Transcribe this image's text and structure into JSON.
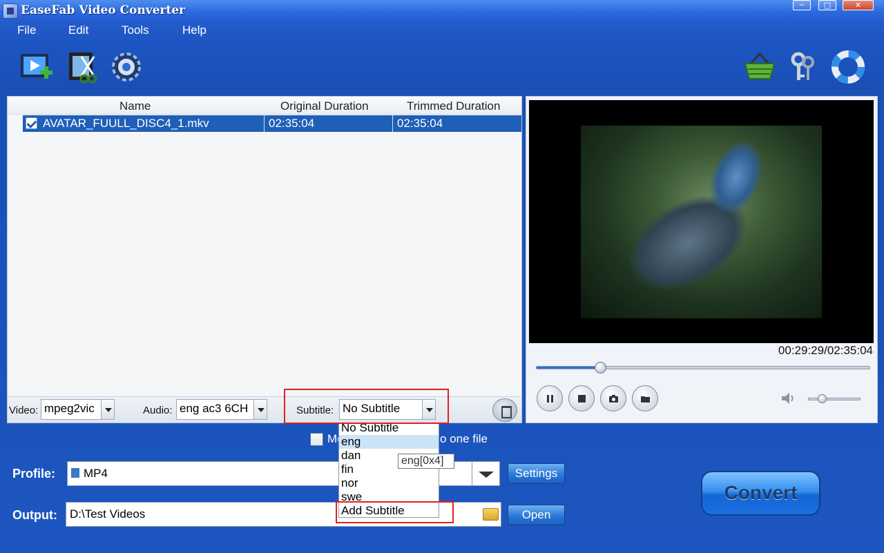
{
  "window": {
    "title": "EaseFab Video Converter"
  },
  "menu": [
    "File",
    "Edit",
    "Tools",
    "Help"
  ],
  "toolbar": {
    "left": [
      "add-video-icon",
      "edit-video-icon",
      "settings-gear-icon"
    ],
    "right": [
      "shopping-basket-icon",
      "keys-icon",
      "lifebuoy-icon"
    ]
  },
  "file_list": {
    "columns": [
      "Name",
      "Original Duration",
      "Trimmed Duration"
    ],
    "rows": [
      {
        "checked": true,
        "name": "AVATAR_FUULL_DISC4_1.mkv",
        "original": "02:35:04",
        "trimmed": "02:35:04"
      }
    ]
  },
  "track_options": {
    "video_label": "Video:",
    "video_value": "mpeg2vic",
    "audio_label": "Audio:",
    "audio_value": "eng ac3 6CH",
    "subtitle_label": "Subtitle:",
    "subtitle_value": "No Subtitle"
  },
  "subtitle_dropdown": {
    "options": [
      "No Subtitle",
      "eng",
      "dan",
      "fin",
      "nor",
      "swe",
      "Add Subtitle"
    ],
    "highlighted": "eng",
    "tooltip": "eng[0x4]"
  },
  "merge": {
    "label_prefix": "Me",
    "label_suffix": "o one file",
    "checked": false
  },
  "preview": {
    "time": "00:29:29/02:35:04",
    "progress": 0.19,
    "volume": 0.25
  },
  "profile": {
    "label": "Profile:",
    "value": "MP4",
    "settings_button": "Settings"
  },
  "output": {
    "label": "Output:",
    "value": "D:\\Test Videos",
    "open_button": "Open"
  },
  "convert_button": "Convert",
  "colors": {
    "accent": "#1f5fb8",
    "highlight_box": "#e02020"
  }
}
